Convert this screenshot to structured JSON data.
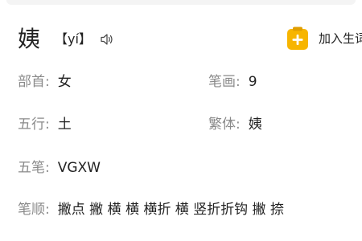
{
  "character": "姨",
  "pinyin": "【yí】",
  "add_button": {
    "label": "加入生词"
  },
  "fields": {
    "radical": {
      "label": "部首:",
      "value": "女"
    },
    "strokes": {
      "label": "笔画:",
      "value": "9"
    },
    "wuxing": {
      "label": "五行:",
      "value": "土"
    },
    "traditional": {
      "label": "繁体:",
      "value": "姨"
    },
    "wubi": {
      "label": "五笔:",
      "value": "VGXW"
    },
    "stroke_order": {
      "label": "笔顺:",
      "value": "撇点 撇 横 横 横折 横 竖折折钩 撇 捺"
    }
  },
  "colors": {
    "accent": "#f7b500",
    "label": "#8a8a8a",
    "text": "#222222"
  },
  "icons": {
    "speaker": "speaker-icon",
    "add": "add-notebook-icon"
  }
}
